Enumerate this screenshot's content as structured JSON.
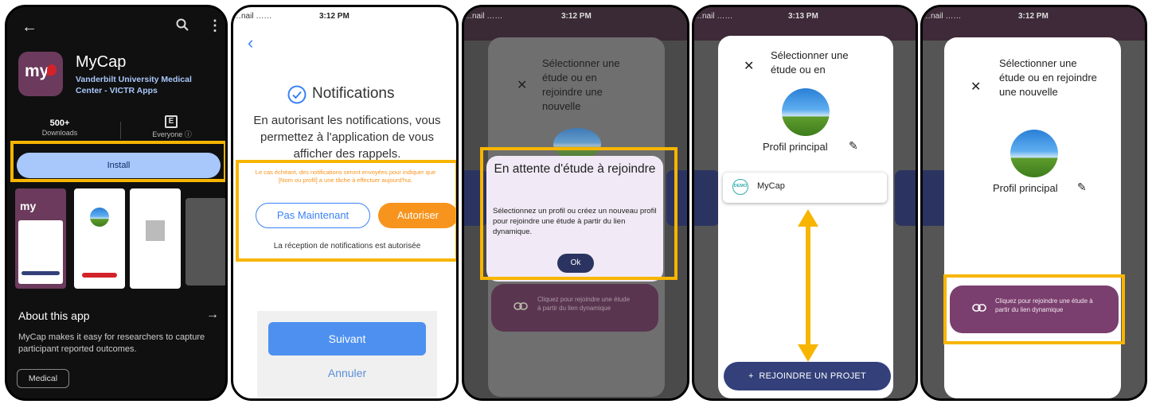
{
  "store": {
    "app_name": "MyCap",
    "developer": "Vanderbilt University Medical Center - VICTR Apps",
    "logo_text": "my",
    "downloads_value": "500+",
    "downloads_label": "Downloads",
    "rating_label": "Everyone ⓘ",
    "install_label": "Install",
    "about_title": "About this app",
    "about_text": "MyCap makes it easy for researchers to capture participant reported outcomes.",
    "category_chip": "Medical"
  },
  "notifications": {
    "status_carrier": "…nail ……",
    "status_time": "3:12 PM",
    "title": "Notifications",
    "body": "En autorisant les notifications, vous permettez à l'application de vous afficher des rappels.",
    "fine_print": "Le cas échéant, des notifications seront envoyées pour indiquer que [Nom ou profil] a une tâche à effectuer aujourd'hui.",
    "not_now_label": "Pas Maintenant",
    "allow_label": "Autoriser",
    "status_message": "La réception de notifications est autorisée",
    "next_label": "Suivant",
    "cancel_label": "Annuler"
  },
  "waiting": {
    "status_carrier": "…nail ……",
    "status_time": "3:12 PM",
    "sheet_title": "Sélectionner une étude ou en rejoindre une nouvelle",
    "dialog_title": "En attente d'étude à rejoindre",
    "dialog_body": "Sélectionnez un profil ou créez un nouveau profil pour rejoindre une étude à partir du lien dynamique.",
    "ok_label": "Ok",
    "join_link_label": "Cliquez pour rejoindre une étude à partir du lien dynamique"
  },
  "select_study": {
    "status_carrier": "…nail ……",
    "status_time": "3:13 PM",
    "sheet_title": "Sélectionner une étude ou en",
    "profile_name": "Profil principal",
    "project_badge": "DEMO",
    "project_name": "MyCap",
    "join_project_label": "REJOINDRE UN PROJET"
  },
  "join_link": {
    "status_carrier": "…nail ……",
    "status_time": "3:12 PM",
    "sheet_title": "Sélectionner une étude ou en rejoindre une nouvelle",
    "profile_name": "Profil principal",
    "join_link_label": "Cliquez pour rejoindre une étude à partir du lien dynamique"
  },
  "colors": {
    "highlight": "#f7b500",
    "install_button": "#a8c7fa",
    "allow_button": "#f7941d",
    "next_button": "#4d90f0",
    "dark_purple": "#6b3a5c",
    "join_button": "#7a3f6e",
    "navy": "#33407a"
  }
}
